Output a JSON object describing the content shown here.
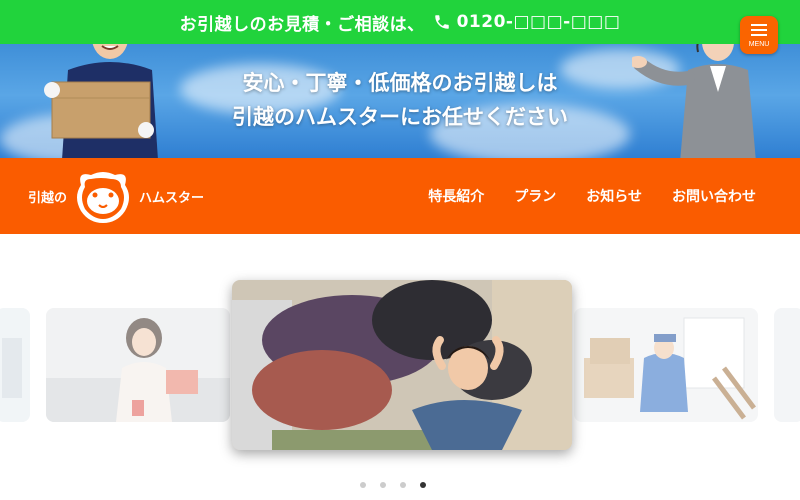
{
  "topbar": {
    "text": "お引越しのお見積・ご相談は、",
    "phone": "0120-□□□-□□□"
  },
  "hero": {
    "line1": "安心・丁寧・低価格のお引越しは",
    "line2": "引越のハムスターにお任せください"
  },
  "menu_button": {
    "label": "MENU"
  },
  "logo": {
    "left": "引越の",
    "right": "ハムスター"
  },
  "nav": {
    "items": [
      {
        "label": "特長紹介"
      },
      {
        "label": "プラン"
      },
      {
        "label": "お知らせ"
      },
      {
        "label": "お問い合わせ"
      }
    ]
  },
  "carousel": {
    "active_index": 3,
    "dot_count": 4
  },
  "colors": {
    "green": "#21d33c",
    "orange": "#fa5c00",
    "blue": "#3f8fd8"
  }
}
